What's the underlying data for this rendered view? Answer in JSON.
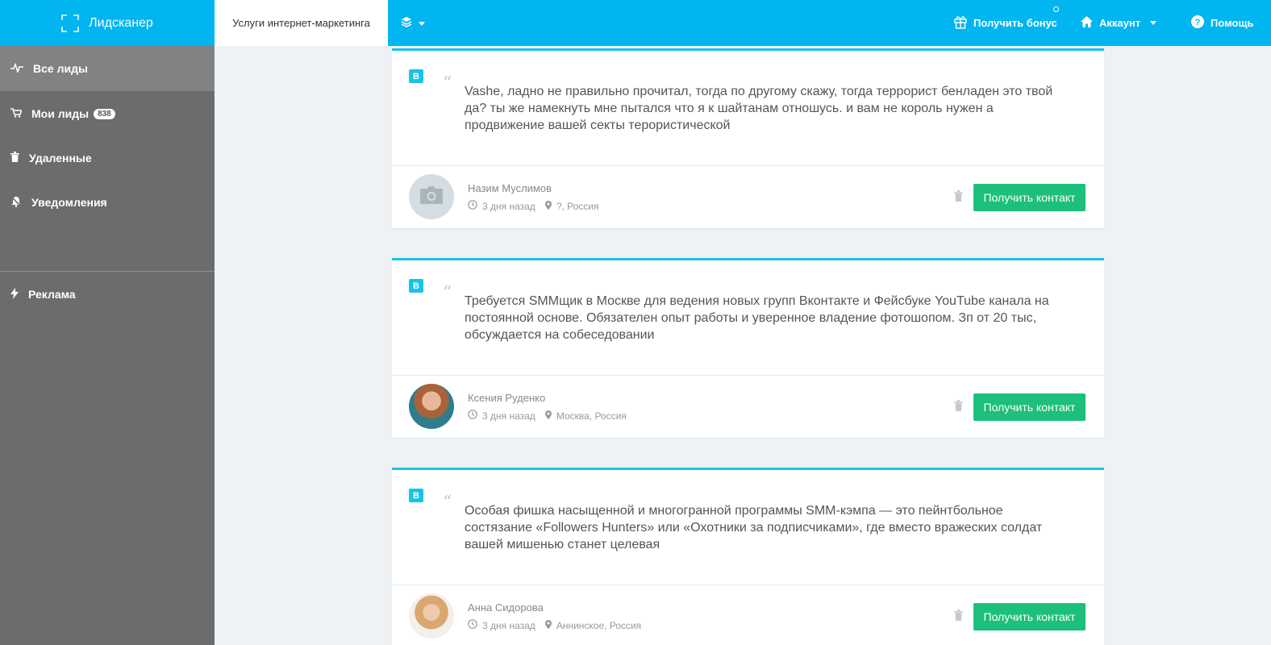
{
  "brand": {
    "name": "Лидсканер"
  },
  "header": {
    "active_tab": "Услуги интернет-маркетинга",
    "bonus": "Получить бонус",
    "account": "Аккаунт",
    "help": "Помощь"
  },
  "sidebar": {
    "items": [
      {
        "label": "Все лиды",
        "icon": "pulse-icon"
      },
      {
        "label": "Мои лиды",
        "icon": "cart-icon",
        "badge": "838"
      },
      {
        "label": "Удаленные",
        "icon": "trash-icon"
      },
      {
        "label": "Уведомления",
        "icon": "bell-off-icon"
      },
      {
        "label": "Реклама",
        "icon": "bolt-icon"
      }
    ]
  },
  "leads": [
    {
      "source": "B",
      "text": "Vashe, ладно не правильно прочитал, тогда по другому скажу, тогда террорист бенладен это твой да? ты же намекнуть мне пытался что я к шайтанам отношусь. и вам не король нужен а продвижение вашей секты терористической",
      "author": "Назим Муслимов",
      "time": "3 дня назад",
      "location": "?, Россия",
      "button": "Получить контакт"
    },
    {
      "source": "B",
      "text": "Требуется SMMщик в Москве для ведения новых групп Вконтакте и Фейсбуке YouTube канала на постоянной основе. Обязателен опыт работы и уверенное владение фотошопом. Зп от 20 тыс, обсуждается на собеседовании",
      "author": "Ксения Руденко",
      "time": "3 дня назад",
      "location": "Москва, Россия",
      "button": "Получить контакт"
    },
    {
      "source": "B",
      "text": "Особая фишка насыщенной и многогранной программы SMM-кэмпа — это пейнтбольное состязание «Followers Hunters» или «Охотники за подписчиками», где вместо вражеских солдат вашей мишенью станет целевая",
      "author": "Анна Сидорова",
      "time": "3 дня назад",
      "location": "Аннинское, Россия",
      "button": "Получить контакт"
    }
  ],
  "colors": {
    "topbar": "#00b5f0",
    "sidebar": "#6c6c6c",
    "accent": "#19c3e8",
    "button": "#1cc07a"
  }
}
